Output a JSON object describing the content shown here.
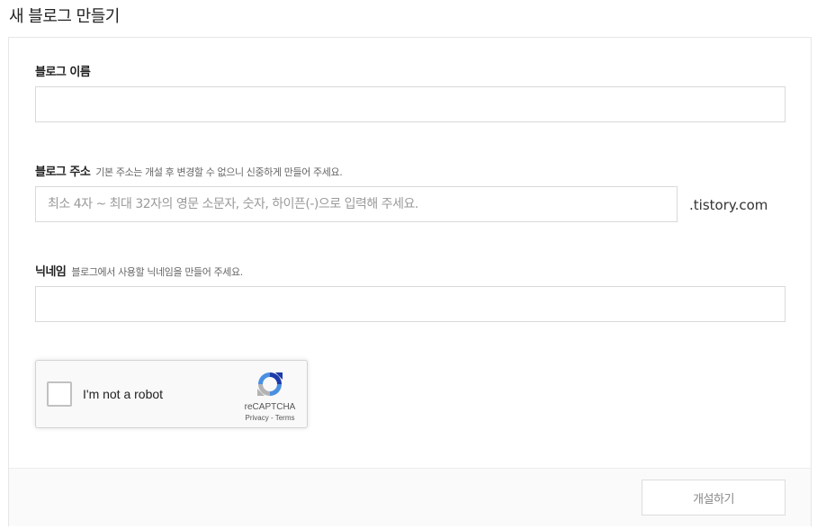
{
  "page": {
    "title": "새 블로그 만들기"
  },
  "form": {
    "blog_name": {
      "label": "블로그 이름",
      "value": "",
      "placeholder": ""
    },
    "blog_address": {
      "label": "블로그 주소",
      "hint": "기본 주소는 개설 후 변경할 수 없으니 신중하게 만들어 주세요.",
      "value": "",
      "placeholder": "최소 4자 ~ 최대 32자의 영문 소문자, 숫자, 하이픈(-)으로 입력해 주세요.",
      "suffix": ".tistory.com"
    },
    "nickname": {
      "label": "닉네임",
      "hint": "블로그에서 사용할 닉네임을 만들어 주세요.",
      "value": "",
      "placeholder": ""
    }
  },
  "recaptcha": {
    "label": "I'm not a robot",
    "brand": "reCAPTCHA",
    "privacy": "Privacy",
    "separator": " - ",
    "terms": "Terms",
    "checked": false,
    "icon": "recaptcha-logo-icon"
  },
  "footer": {
    "submit_label": "개설하기"
  },
  "colors": {
    "border": "#d9d9d9",
    "footer_bg": "#fafafa",
    "recaptcha_blue": "#1c3aa9",
    "recaptcha_light_blue": "#4a90e2",
    "recaptcha_gray": "#b3b3b3"
  }
}
